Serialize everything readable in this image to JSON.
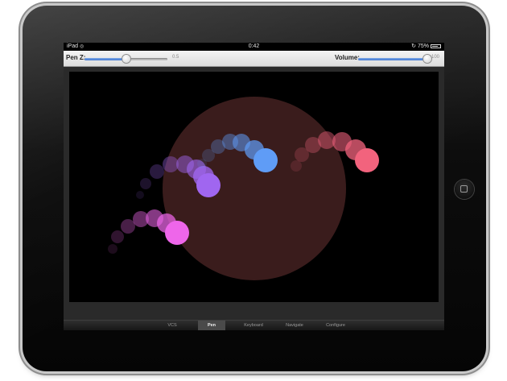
{
  "status_bar": {
    "device": "iPad",
    "time": "0:42",
    "battery": "75%",
    "battery_level": 0.75,
    "icons": [
      "wifi-icon",
      "rotation-lock-icon",
      "battery-icon"
    ]
  },
  "toolbar": {
    "pen_label": "Pen Z:",
    "pen_value": "0.5",
    "pen_level": 0.5,
    "volume_label": "Volume:",
    "volume_value": "100",
    "volume_level": 1.0
  },
  "tabs": [
    {
      "label": "VCS",
      "active": false
    },
    {
      "label": "Pen",
      "active": true
    },
    {
      "label": "Keyboard",
      "active": false
    },
    {
      "label": "Navigate",
      "active": false
    },
    {
      "label": "Configure",
      "active": false
    }
  ],
  "colors": {
    "slider_accent": "#3f74cf",
    "center_circle": "#3a1c1c",
    "trail_purple": "#a066f0",
    "trail_blue": "#5f9cf6",
    "trail_red": "#f2637d",
    "trail_pink": "#ee66ea"
  }
}
